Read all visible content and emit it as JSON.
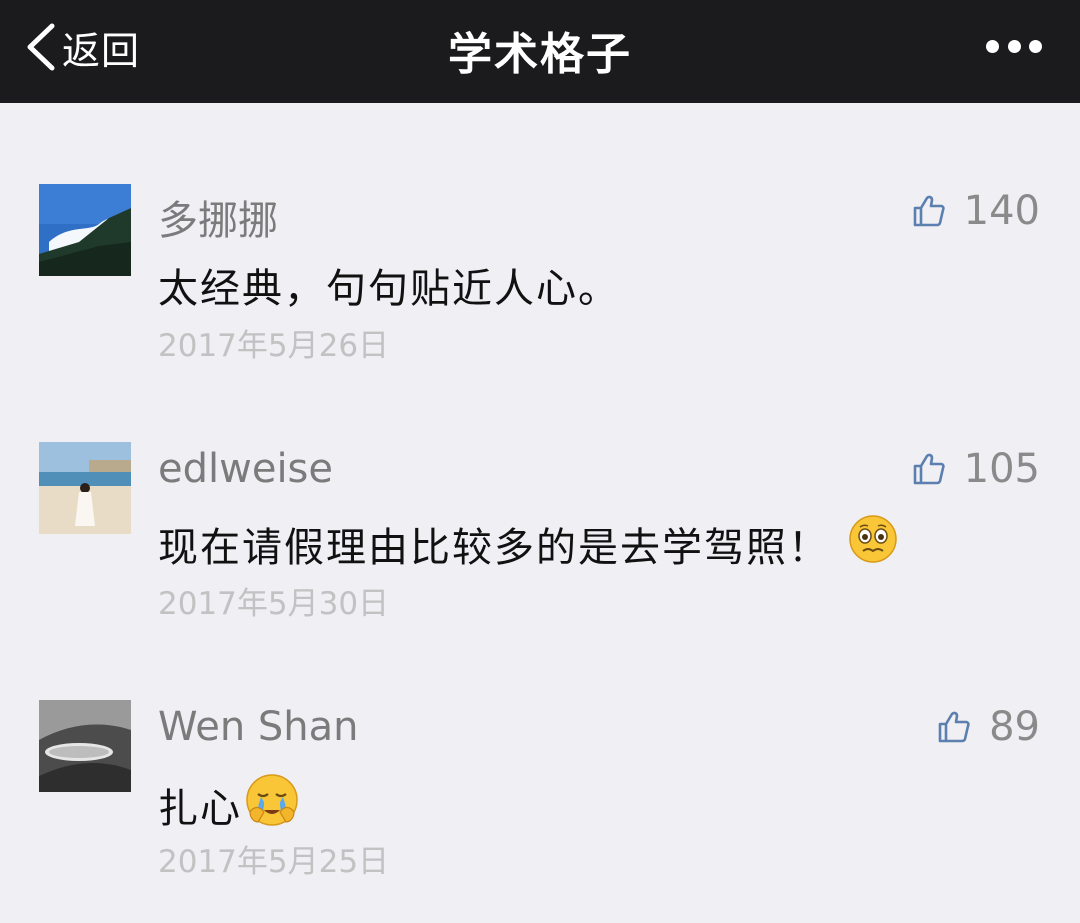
{
  "navbar": {
    "back_label": "返回",
    "title": "学术格子",
    "more_icon": "more-dots-icon"
  },
  "comments": [
    {
      "nickname": "多挪挪",
      "likes": "140",
      "text": "太经典，句句贴近人心。",
      "date": "2017年5月26日"
    },
    {
      "nickname": "edlweise",
      "likes": "105",
      "text": "现在请假理由比较多的是去学驾照！",
      "emoji": "pleading-face-emoji",
      "date": "2017年5月30日"
    },
    {
      "nickname": "Wen Shan",
      "likes": "89",
      "text": "扎心",
      "emoji": "crying-face-emoji",
      "date": "2017年5月25日"
    }
  ],
  "colors": {
    "navbar_bg": "#1b1b1d",
    "page_bg": "#efeff4",
    "like_icon": "#5b7fae"
  }
}
